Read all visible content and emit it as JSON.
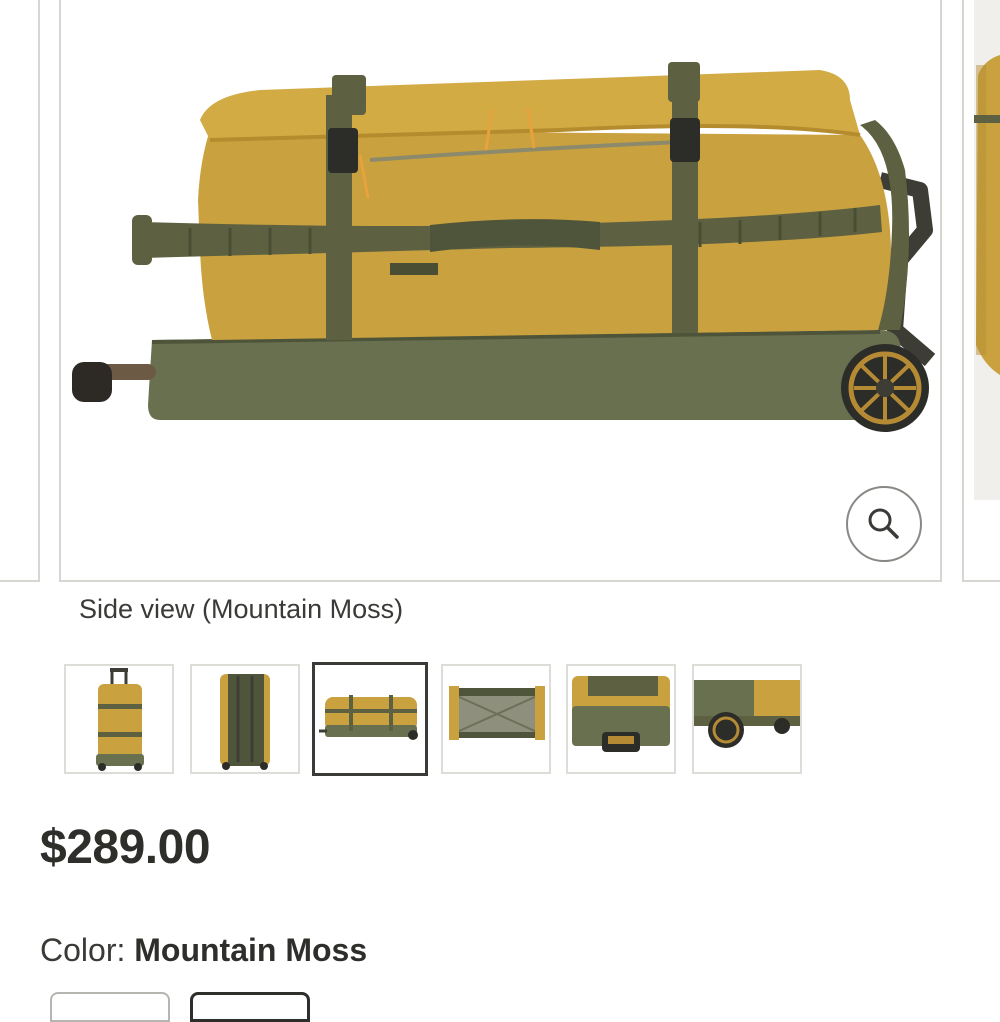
{
  "gallery": {
    "caption": "Side view (Mountain Moss)",
    "zoom_icon": "magnifier-icon",
    "thumbnails": [
      {
        "view": "front upright"
      },
      {
        "view": "back upright"
      },
      {
        "view": "side lying",
        "selected": true
      },
      {
        "view": "open interior"
      },
      {
        "view": "bottom handle"
      },
      {
        "view": "wheel detail"
      }
    ]
  },
  "price": "$289.00",
  "color": {
    "label": "Color:",
    "value": "Mountain Moss"
  },
  "colors": {
    "bag_body": "#c9a13f",
    "bag_trim": "#5d6141",
    "bag_base": "#68704f",
    "border": "#d8d6d1",
    "selected_border": "#3a3a37",
    "text": "#2e2e2b"
  }
}
